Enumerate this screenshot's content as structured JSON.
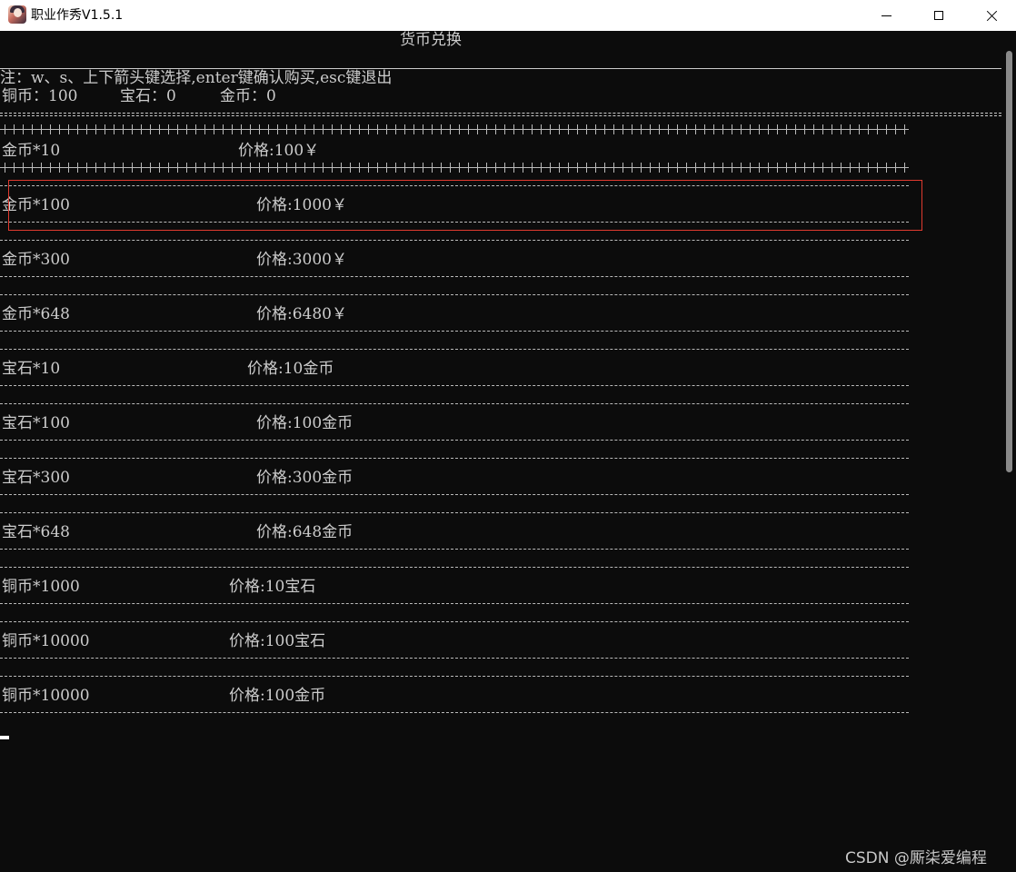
{
  "window": {
    "title": "职业作秀V1.5.1"
  },
  "console": {
    "header_title": "货币兑换",
    "note": "注：w、s、上下箭头键选择,enter键确认购买,esc键退出",
    "balance": {
      "copper": "铜币：100",
      "gem": "宝石：0",
      "gold": "金币：0"
    },
    "items": [
      {
        "name": "金币*10",
        "price": "价格:100￥"
      },
      {
        "name": "金币*100",
        "price": "价格:1000￥"
      },
      {
        "name": "金币*300",
        "price": "价格:3000￥"
      },
      {
        "name": "金币*648",
        "price": "价格:6480￥"
      },
      {
        "name": "宝石*10",
        "price": "价格:10金币"
      },
      {
        "name": "宝石*100",
        "price": "价格:100金币"
      },
      {
        "name": "宝石*300",
        "price": "价格:300金币"
      },
      {
        "name": "宝石*648",
        "price": "价格:648金币"
      },
      {
        "name": "铜币*1000",
        "price": "价格:10宝石"
      },
      {
        "name": "铜币*10000",
        "price": "价格:100宝石"
      },
      {
        "name": "铜币*10000",
        "price": "价格:100金币"
      }
    ],
    "selected_index": 0
  },
  "watermark": "CSDN @厮柒爱编程",
  "colors": {
    "console_bg": "#0c0c0c",
    "console_text": "#cccccc",
    "highlight_box": "#e03a2f"
  },
  "icons": {
    "app": "app-avatar-icon",
    "minimize": "minimize-icon",
    "maximize": "maximize-icon",
    "close": "close-icon"
  }
}
